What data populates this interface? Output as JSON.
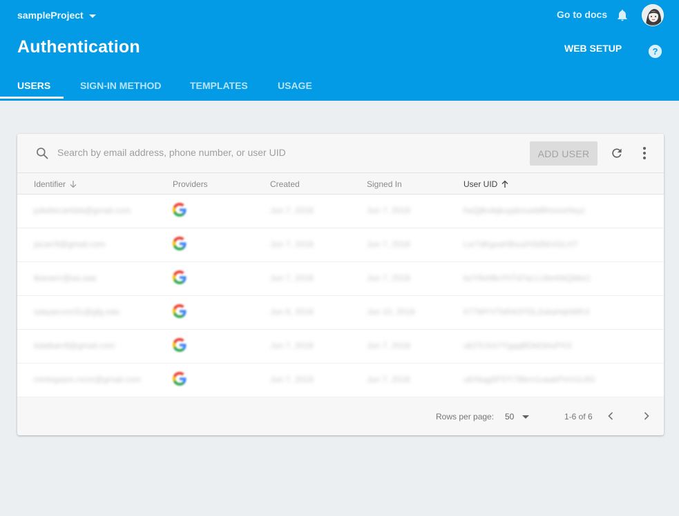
{
  "header": {
    "project_name": "sampleProject",
    "go_to_docs": "Go to docs",
    "title": "Authentication",
    "web_setup": "WEB SETUP",
    "background": "#039be5"
  },
  "tabs": [
    {
      "label": "USERS",
      "active": true
    },
    {
      "label": "SIGN-IN METHOD",
      "active": false
    },
    {
      "label": "TEMPLATES",
      "active": false
    },
    {
      "label": "USAGE",
      "active": false
    }
  ],
  "toolbar": {
    "search_placeholder": "Search by email address, phone number, or user UID",
    "add_user_label": "ADD USER"
  },
  "table": {
    "columns": [
      {
        "label": "Identifier",
        "sort": "down"
      },
      {
        "label": "Providers"
      },
      {
        "label": "Created"
      },
      {
        "label": "Signed In"
      },
      {
        "label": "User UID",
        "sort": "up"
      }
    ],
    "rows": [
      {
        "identifier": "juliettecarlsbb@gmail.com",
        "provider": "google-icon",
        "created": "Jun 7, 2018",
        "signed_in": "Jun 7, 2018",
        "uid": "haQjlkvikjkuyjdrzuebl8hrsnoHeyz"
      },
      {
        "identifier": "jacarr9@gmail.com",
        "provider": "google-icon",
        "created": "Jun 7, 2018",
        "signed_in": "Jun 7, 2018",
        "uid": "Lxr7dKgvaH8vuzH3d5kVGLH7"
      },
      {
        "identifier": "tkanarrr@aa.aaa",
        "provider": "google-icon",
        "created": "Jun 7, 2018",
        "signed_in": "Jun 7, 2018",
        "uid": "bzY9vhBoYhTd7aLLUbmhbQbbs1"
      },
      {
        "identifier": "sdayarcom31@gfg.edu",
        "provider": "google-icon",
        "created": "Jun 6, 2018",
        "signed_in": "Jun 10, 2018",
        "uid": "h7TMYVTbRA3YDL2ukaHqhWKX"
      },
      {
        "identifier": "kdatbarr9@gmail.com",
        "provider": "google-icon",
        "created": "Jun 7, 2018",
        "signed_in": "Jun 7, 2018",
        "uid": "uk2TcXm7YgqqBDkEkhsPXX"
      },
      {
        "identifier": "mintvgasm.rvcnr@gmail.com",
        "provider": "google-icon",
        "created": "Jun 7, 2018",
        "signed_in": "Jun 7, 2018",
        "uid": "u6Xkqg5F5Tr7Bkrn1uaakPmVzL6G"
      }
    ]
  },
  "footer": {
    "rows_per_page_label": "Rows per page:",
    "rows_per_page_value": "50",
    "range": "1-6 of 6"
  }
}
